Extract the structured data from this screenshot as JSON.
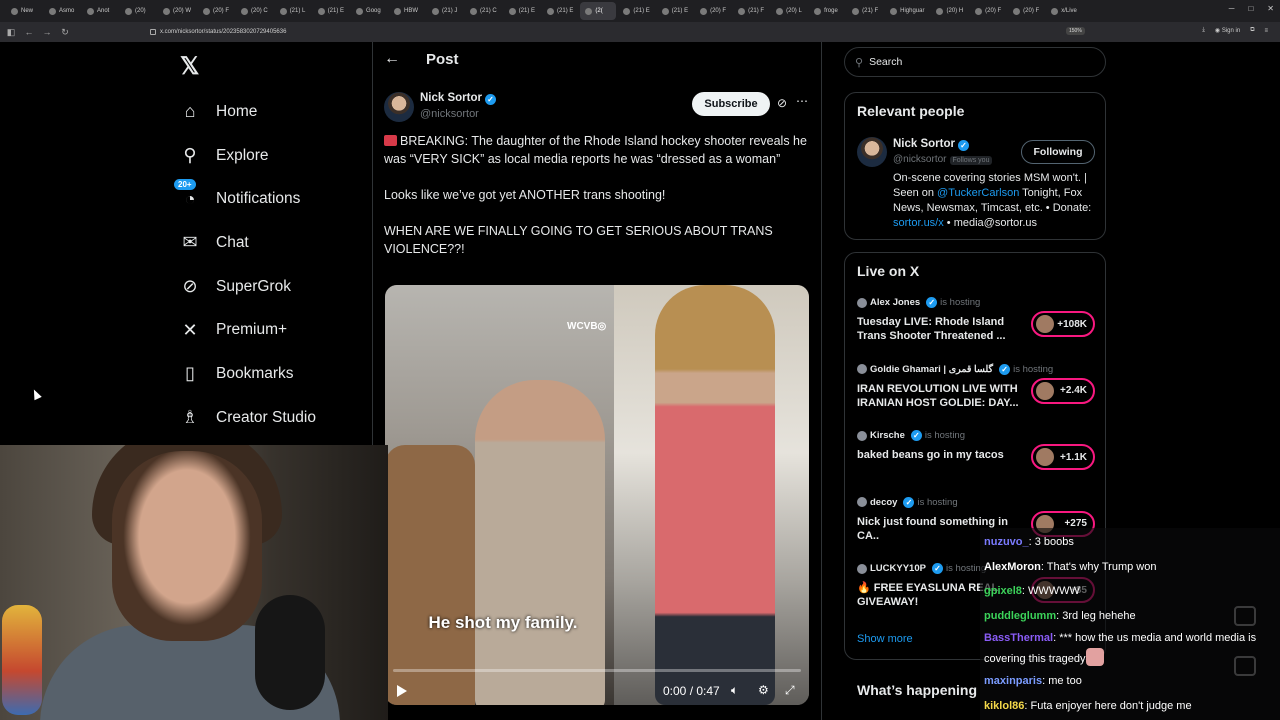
{
  "browser": {
    "tabs": [
      "New",
      "Asmo",
      "Anot",
      "(20)",
      "(20) W",
      "(20) F",
      "(20) C",
      "(21) L",
      "(21) E",
      "Goog",
      "HBW",
      "(21) J",
      "(21) C",
      "(21) E",
      "(21) E",
      "(2(",
      "(21) E",
      "(21) E",
      "(20) F",
      "(21) F",
      "(20) L",
      "froge",
      "(21) F",
      "Highguar",
      "(20) H",
      "(20) F",
      "(20) F",
      "x/Live"
    ],
    "active_tab": 15,
    "url": "x.com/nicksortor/status/2023583020729405636",
    "zoom": "150%",
    "sign_in": "Sign in"
  },
  "nav": {
    "items": [
      {
        "label": "Home",
        "icon": "home-icon",
        "glyph": "⌂"
      },
      {
        "label": "Explore",
        "icon": "search-icon",
        "glyph": "⚲"
      },
      {
        "label": "Notifications",
        "icon": "bell-icon",
        "glyph": "◔",
        "badge": "20+"
      },
      {
        "label": "Chat",
        "icon": "mail-icon",
        "glyph": "✉"
      },
      {
        "label": "SuperGrok",
        "icon": "grok-icon",
        "glyph": "⊘"
      },
      {
        "label": "Premium+",
        "icon": "x-icon",
        "glyph": "✕"
      },
      {
        "label": "Bookmarks",
        "icon": "bookmark-icon",
        "glyph": "▯"
      },
      {
        "label": "Creator Studio",
        "icon": "creator-icon",
        "glyph": "♗"
      }
    ]
  },
  "post": {
    "header": "Post",
    "author_name": "Nick Sortor",
    "author_handle": "@nicksortor",
    "subscribe": "Subscribe",
    "paragraphs": [
      "BREAKING: The daughter of the Rhode Island hockey shooter reveals he was “VERY SICK” as local media reports he was “dressed as a woman”",
      "Looks like we’ve got yet ANOTHER trans shooting!",
      "WHEN ARE WE FINALLY GOING TO GET SERIOUS ABOUT TRANS VIOLENCE??!"
    ],
    "video": {
      "watermark": "WCVB◎",
      "caption": "He shot my family.",
      "time": "0:00 / 0:47",
      "progress": 0
    }
  },
  "search": {
    "placeholder": "Search"
  },
  "relevant": {
    "title": "Relevant people",
    "name": "Nick Sortor",
    "handle": "@nicksortor",
    "follows_you": "Follows you",
    "button": "Following",
    "bio_1": "On-scene covering stories MSM won't. | Seen on ",
    "bio_link1": "@TuckerCarlson",
    "bio_2": " Tonight, Fox News, Newsmax, Timcast, etc. • Donate: ",
    "bio_link2": "sortor.us/x",
    "bio_3": " • media@sortor.us"
  },
  "live": {
    "title": "Live on X",
    "hosting": "is hosting",
    "items": [
      {
        "host": "Alex Jones",
        "title": "Tuesday LIVE: Rhode Island Trans Shooter Threatened ...",
        "count": "+108K"
      },
      {
        "host": "Goldie Ghamari | گلسا قمری",
        "title": "IRAN REVOLUTION LIVE WITH IRANIAN HOST GOLDIE: DAY...",
        "count": "+2.4K"
      },
      {
        "host": "Kirsche",
        "title": "baked beans go in my tacos",
        "count": "+1.1K"
      },
      {
        "host": "decoy",
        "title": "Nick just found something in CA..",
        "count": "+275"
      },
      {
        "host": "LUCKYY10P",
        "title": "🔥 FREE EYASLUNA REAL GIVEAWAY!",
        "count": "+85"
      }
    ],
    "show_more": "Show more"
  },
  "happening": "What’s happening",
  "chat": [
    {
      "user": "nuzuvo_",
      "color": "#7b7bff",
      "msg": "3 boobs"
    },
    {
      "user": "AlexMoron",
      "color": "#ffffff",
      "msg": "That's why Trump won"
    },
    {
      "user": "gpixel8",
      "color": "#3cd35a",
      "msg": "WWWWW"
    },
    {
      "user": "puddleglumm",
      "color": "#3cd35a",
      "msg": "3rd leg hehehe"
    },
    {
      "user": "BassThermal",
      "color": "#8a5cf6",
      "msg": "*** how the us media and world media is covering this tragedy"
    },
    {
      "user": "maxinparis",
      "color": "#7b9cff",
      "msg": "me too"
    },
    {
      "user": "kiklol86",
      "color": "#f5d94a",
      "msg": "Futa enjoyer here don't judge me"
    }
  ]
}
